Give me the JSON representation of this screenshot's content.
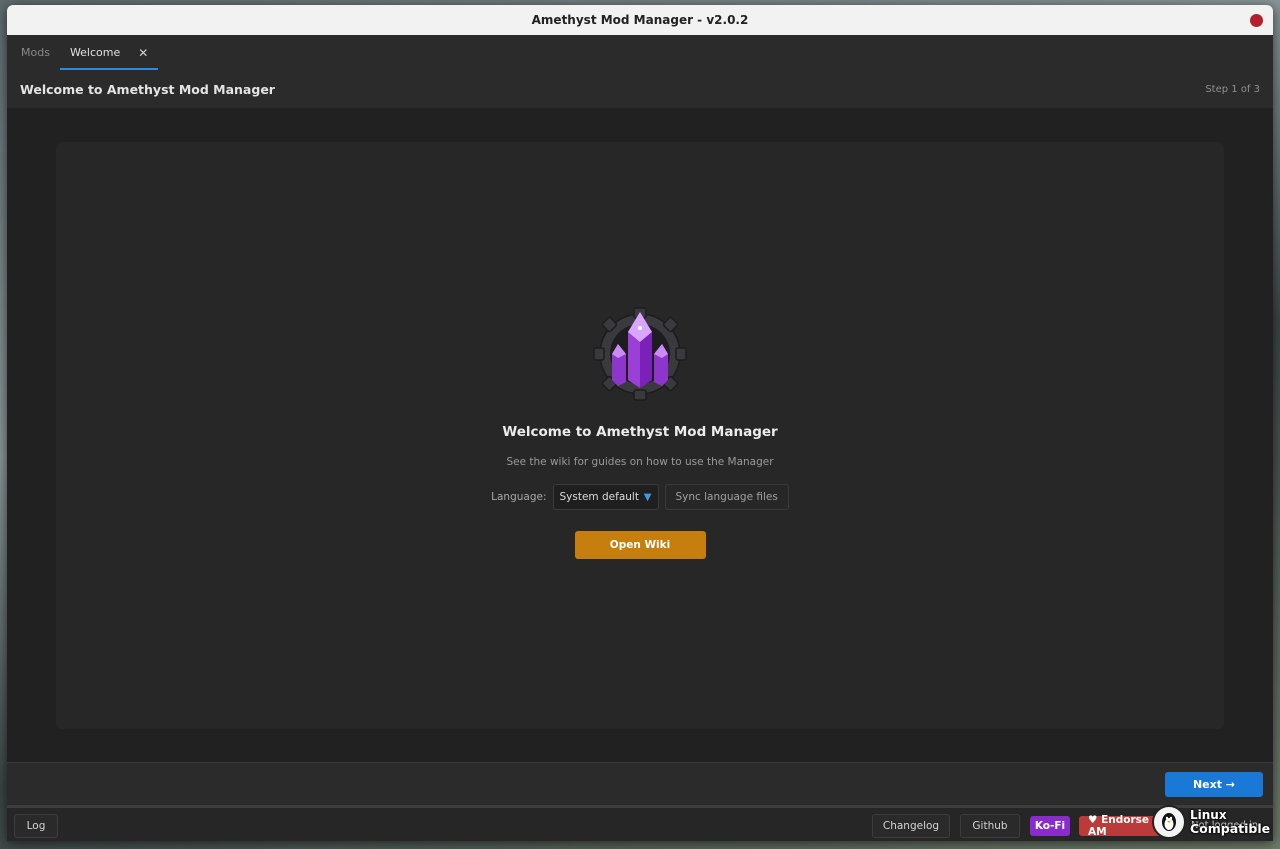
{
  "window": {
    "title": "Amethyst Mod Manager - v2.0.2"
  },
  "tabs": [
    {
      "label": "Mods",
      "active": false
    },
    {
      "label": "Welcome",
      "active": true,
      "close": "✕"
    }
  ],
  "header": {
    "title": "Welcome to Amethyst Mod Manager",
    "step": "Step 1 of 3"
  },
  "welcome": {
    "title": "Welcome to Amethyst Mod Manager",
    "subtitle": "See the wiki for guides on how to use the Manager",
    "language_label": "Language:",
    "language_value": "System default",
    "sync_label": "Sync language files",
    "wiki_label": "Open Wiki"
  },
  "footer": {
    "next_label": "Next →"
  },
  "statusbar": {
    "log_label": "Log",
    "changelog_label": "Changelog",
    "github_label": "Github",
    "kofi_label": "Ko-Fi",
    "endorse_label": "♥ Endorse AM",
    "login_status": "Not logged in"
  },
  "badge": {
    "line1": "Linux",
    "line2": "Compatible"
  },
  "colors": {
    "accent": "#1a78d6",
    "wiki_button": "#c67e0e",
    "kofi": "#8a2bcc",
    "endorse": "#bb3a3a",
    "close_dot": "#b3202c"
  },
  "icons": {
    "logo": "amethyst-crystal-gear-icon",
    "close": "close-icon",
    "dropdown": "chevron-down-icon"
  }
}
